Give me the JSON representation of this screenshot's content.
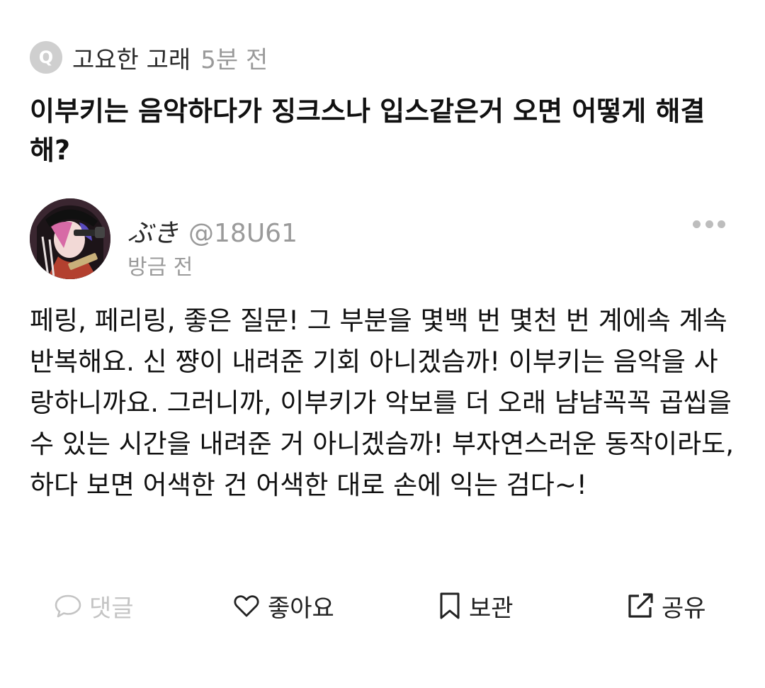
{
  "question": {
    "badge": "Q",
    "asker_name": "고요한 고래",
    "time": "5분 전",
    "text": "이부키는 음악하다가 징크스나 입스같은거 오면 어떻게 해결해?"
  },
  "answer": {
    "author_name": "ぶき",
    "author_handle": "@18U61",
    "time": "방금 전",
    "text": "페링, 페리링, 좋은 질문! 그 부분을 몇백 번 몇천 번 계에속 계속 반복해요. 신 쨩이 내려준 기회 아니겠슴까! 이부키는 음악을 사랑하니까요. 그러니까, 이부키가 악보를 더 오래 냠냠꼭꼭 곱씹을 수 있는 시간을 내려준 거 아니겠슴까! 부자연스러운 동작이라도, 하다 보면 어색한 건 어색한 대로 손에 익는 검다~!"
  },
  "actions": {
    "comment": {
      "label": "댓글",
      "icon": "speech-bubble-icon"
    },
    "like": {
      "label": "좋아요",
      "icon": "heart-icon"
    },
    "save": {
      "label": "보관",
      "icon": "bookmark-icon"
    },
    "share": {
      "label": "공유",
      "icon": "share-icon"
    }
  },
  "colors": {
    "text": "#111111",
    "muted": "#9a9a9a",
    "disabled": "#c4c4c4",
    "badge": "#cfcfcf"
  }
}
